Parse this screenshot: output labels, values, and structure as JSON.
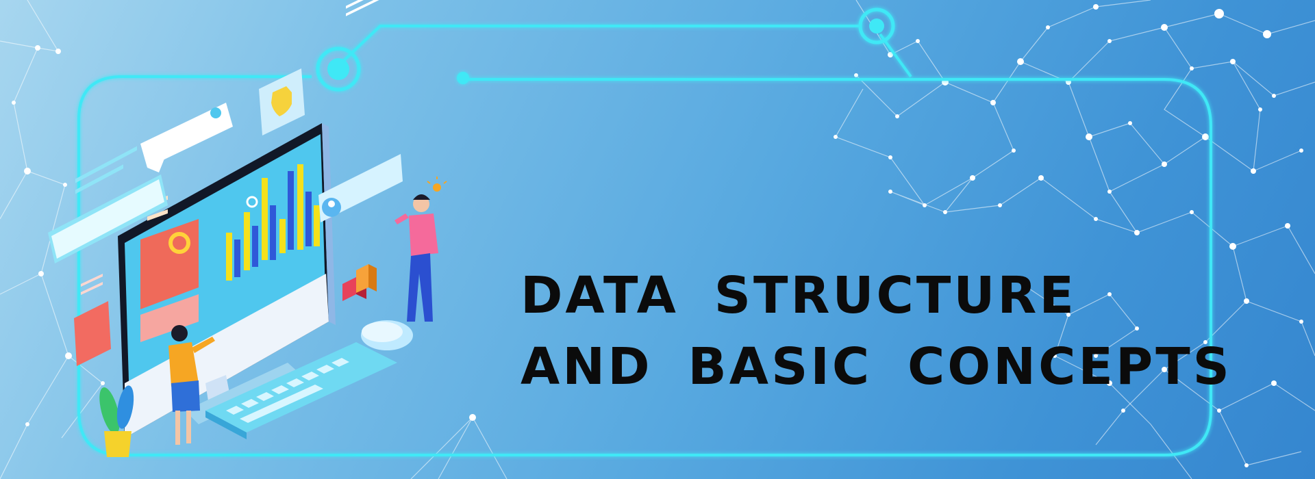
{
  "banner": {
    "title_line_1": "DATA STRUCTURE",
    "title_line_2": "AND BASIC CONCEPTS"
  },
  "colors": {
    "frame": "#3fe8f6",
    "title": "#0b0b0b",
    "network": "#ffffff",
    "chart_yellow": "#f5e11b",
    "chart_blue": "#2f58d8",
    "accent_red": "#e8425a",
    "accent_orange": "#f7a23a"
  },
  "icons": [
    "shield-icon",
    "user-avatar-icon",
    "gear-icon",
    "lightbulb-icon",
    "pie-chart-icon"
  ]
}
